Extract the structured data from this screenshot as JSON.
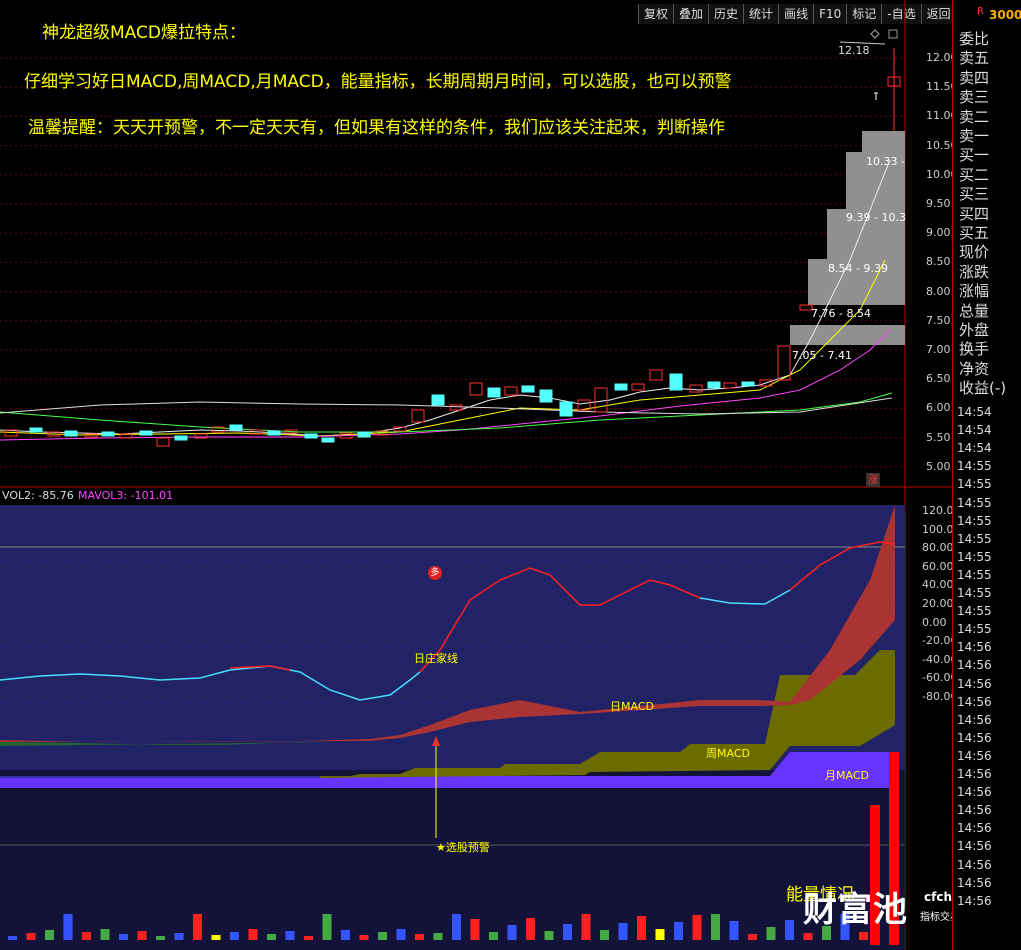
{
  "toolbar": [
    "复权",
    "叠加",
    "历史",
    "统计",
    "画线",
    "F10",
    "标记",
    "-自选",
    "返回"
  ],
  "corner": {
    "r": "R",
    "code": "3000"
  },
  "annotations": {
    "title": "神龙超级MACD爆拉特点：",
    "line1": "仔细学习好日MACD,周MACD,月MACD，能量指标，长期周期月时间，可以选股，也可以预警",
    "line2": "温馨提醒：天天开预警，不一定天天有，但如果有这样的条件，我们应该关注起来，判断操作"
  },
  "price_axis": [
    "12.00",
    "11.50",
    "11.00",
    "10.50",
    "10.00",
    "9.50",
    "9.00",
    "8.50",
    "8.00",
    "7.50",
    "7.00",
    "6.50",
    "6.00",
    "5.50",
    "5.00"
  ],
  "max_price": "12.18",
  "price_bands": [
    "10.33 -",
    "9.39 - 10.3",
    "8.54 - 9.39",
    "7.76 - 8.54",
    "7.05 - 7.41"
  ],
  "limit_badge": "涨",
  "indicator": {
    "vol_label": "VOL2: -85.76",
    "mavol_label": "MAVOL3: -101.01",
    "axis": [
      "120.0",
      "100.0",
      "80.00",
      "60.00",
      "40.00",
      "20.00",
      "0.00",
      "-20.00",
      "-40.00",
      "-60.00",
      "-80.00"
    ],
    "marker_icon": "多",
    "day_zhuang": "日庄家线",
    "day_macd": "日MACD",
    "week_macd": "周MACD",
    "month_macd": "月MACD",
    "alert": "★选股预警",
    "energy": "能量情况"
  },
  "watermark": {
    "brand": "财富池",
    "site": "cfchi.com",
    "sub": "指标交易平台"
  },
  "right_panel": {
    "labels": [
      "委比",
      "卖五",
      "卖四",
      "卖三",
      "卖二",
      "卖一",
      "买一",
      "买二",
      "买三",
      "买四",
      "买五",
      "现价",
      "涨跌",
      "涨幅",
      "总量",
      "外盘",
      "换手",
      "净资",
      "收益(-)"
    ],
    "times": [
      "14:54",
      "14:54",
      "14:54",
      "14:55",
      "14:55",
      "14:55",
      "14:55",
      "14:55",
      "14:55",
      "14:55",
      "14:55",
      "14:55",
      "14:55",
      "14:56",
      "14:56",
      "14:56",
      "14:56",
      "14:56",
      "14:56",
      "14:56",
      "14:56",
      "14:56",
      "14:56",
      "14:56",
      "14:56",
      "14:56",
      "14:56",
      "14:56"
    ]
  },
  "colors": {
    "up": "#ff3030",
    "down": "#54ffff",
    "panel": "#222266",
    "accent": "#ffff00"
  }
}
